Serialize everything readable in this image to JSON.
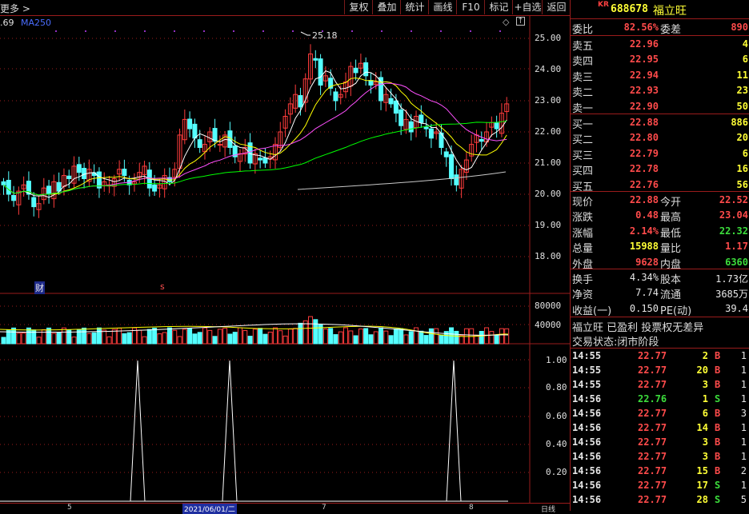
{
  "toolbar": {
    "left_label": "更多 >",
    "buttons": [
      "复权",
      "叠加",
      "统计",
      "画线",
      "F10",
      "标记",
      "+自选",
      "返回"
    ]
  },
  "legend": {
    "ma5_val": ".69",
    "ma250": "MA250",
    "peak": "25.18"
  },
  "price_axis": [
    "25.00",
    "24.00",
    "23.00",
    "22.00",
    "21.00",
    "20.00",
    "19.00",
    "18.00"
  ],
  "vol_axis": [
    "80000",
    "40000"
  ],
  "ind_axis": [
    "1.00",
    "0.80",
    "0.60",
    "0.40",
    "0.20"
  ],
  "markers": {
    "cai": "财",
    "s": "s"
  },
  "date_axis": {
    "m5": "5",
    "date": "2021/06/01/二",
    "m7": "7",
    "m8": "8",
    "period": "日线"
  },
  "stock": {
    "badge": "KR",
    "code": "688678",
    "name": "福立旺"
  },
  "order": {
    "weibi_label": "委比",
    "weibi": "82.56%",
    "weicha_label": "委差",
    "weicha": "890",
    "asks": [
      {
        "label": "卖五",
        "price": "22.96",
        "vol": "4"
      },
      {
        "label": "卖四",
        "price": "22.95",
        "vol": "6"
      },
      {
        "label": "卖三",
        "price": "22.94",
        "vol": "11"
      },
      {
        "label": "卖二",
        "price": "22.93",
        "vol": "23"
      },
      {
        "label": "卖一",
        "price": "22.90",
        "vol": "50"
      }
    ],
    "bids": [
      {
        "label": "买一",
        "price": "22.88",
        "vol": "886"
      },
      {
        "label": "买二",
        "price": "22.80",
        "vol": "20"
      },
      {
        "label": "买三",
        "price": "22.79",
        "vol": "6"
      },
      {
        "label": "买四",
        "price": "22.78",
        "vol": "16"
      },
      {
        "label": "买五",
        "price": "22.76",
        "vol": "56"
      }
    ]
  },
  "quote": [
    {
      "l1": "现价",
      "v1": "22.88",
      "c1": "red",
      "l2": "今开",
      "v2": "22.52",
      "c2": "red"
    },
    {
      "l1": "涨跌",
      "v1": "0.48",
      "c1": "red",
      "l2": "最高",
      "v2": "23.04",
      "c2": "red"
    },
    {
      "l1": "涨幅",
      "v1": "2.14%",
      "c1": "red",
      "l2": "最低",
      "v2": "22.32",
      "c2": "green"
    },
    {
      "l1": "总量",
      "v1": "15988",
      "c1": "yellow",
      "l2": "量比",
      "v2": "1.17",
      "c2": "red"
    },
    {
      "l1": "外盘",
      "v1": "9628",
      "c1": "red",
      "l2": "内盘",
      "v2": "6360",
      "c2": "green"
    }
  ],
  "fund": [
    {
      "l1": "换手",
      "v1": "4.34%",
      "l2": "股本",
      "v2": "1.73亿"
    },
    {
      "l1": "净资",
      "v1": "7.74",
      "l2": "流通",
      "v2": "3685万"
    },
    {
      "l1": "收益(一)",
      "v1": "0.150",
      "l2": "PE(动)",
      "v2": "39.4"
    }
  ],
  "notice": "福立旺 已盈利 投票权无差异",
  "status": "交易状态:闭市阶段",
  "ticks": [
    {
      "t": "14:55",
      "p": "22.77",
      "v": "2",
      "d": "B",
      "n": "1"
    },
    {
      "t": "14:55",
      "p": "22.77",
      "v": "20",
      "d": "B",
      "n": "1"
    },
    {
      "t": "14:55",
      "p": "22.77",
      "v": "3",
      "d": "B",
      "n": "1"
    },
    {
      "t": "14:56",
      "p": "22.76",
      "v": "1",
      "d": "S",
      "n": "1"
    },
    {
      "t": "14:56",
      "p": "22.77",
      "v": "6",
      "d": "B",
      "n": "3"
    },
    {
      "t": "14:56",
      "p": "22.77",
      "v": "14",
      "d": "B",
      "n": "1"
    },
    {
      "t": "14:56",
      "p": "22.77",
      "v": "3",
      "d": "B",
      "n": "1"
    },
    {
      "t": "14:56",
      "p": "22.77",
      "v": "3",
      "d": "B",
      "n": "1"
    },
    {
      "t": "14:56",
      "p": "22.77",
      "v": "15",
      "d": "B",
      "n": "2"
    },
    {
      "t": "14:56",
      "p": "22.77",
      "v": "17",
      "d": "S",
      "n": "1"
    },
    {
      "t": "14:56",
      "p": "22.77",
      "v": "28",
      "d": "S",
      "n": "5"
    }
  ],
  "colors": {
    "up": "#ff3c3c",
    "down": "#54ffff",
    "ma5": "#ffffff",
    "ma10": "#ffff00",
    "ma20": "#ff50ff",
    "ma60": "#00ff00",
    "ma250": "#c8c8c8",
    "grid": "#9a1c1c"
  }
}
